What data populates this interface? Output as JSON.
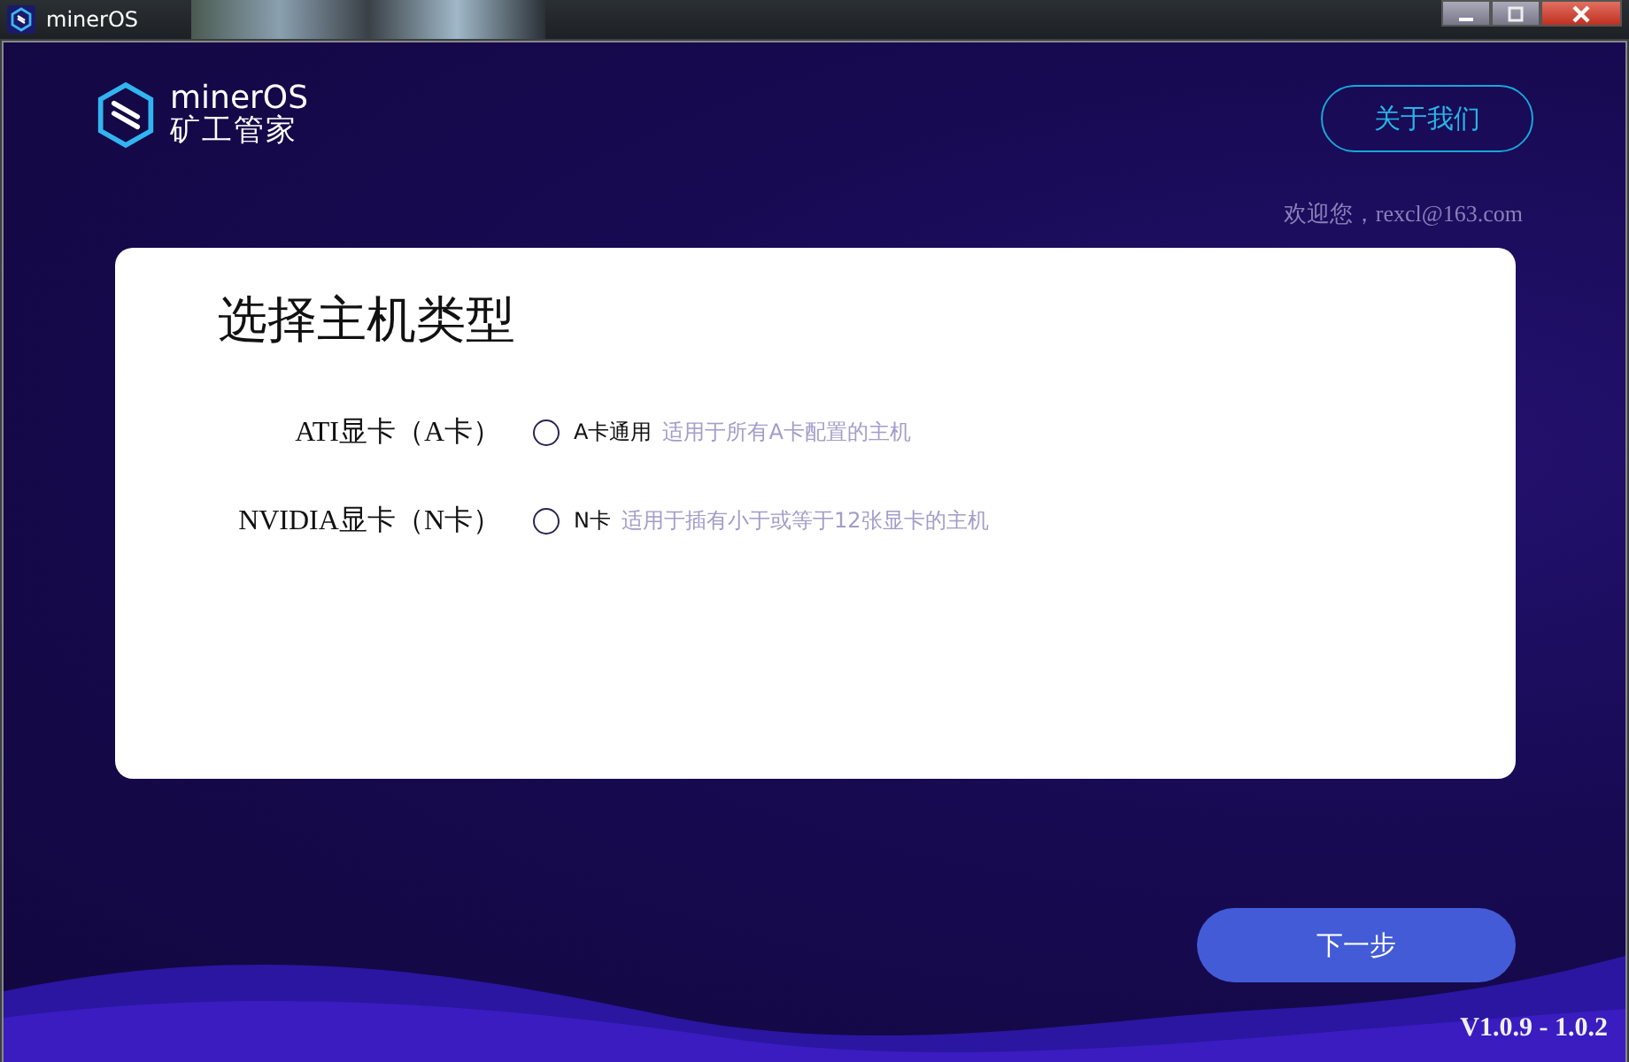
{
  "window": {
    "title": "minerOS"
  },
  "header": {
    "brand": "minerOS",
    "brand_subtitle": "矿工管家",
    "about_button": "关于我们",
    "welcome": "欢迎您，rexcl@163.com"
  },
  "card": {
    "title": "选择主机类型",
    "options": [
      {
        "label": "ATI显卡（A卡）",
        "name": "A卡通用",
        "description": "适用于所有A卡配置的主机",
        "selected": false
      },
      {
        "label": "NVIDIA显卡（N卡）",
        "name": "N卡",
        "description": "适用于插有小于或等于12张显卡的主机",
        "selected": false
      }
    ]
  },
  "next_button": "下一步",
  "version": "V1.0.9 - 1.0.2"
}
